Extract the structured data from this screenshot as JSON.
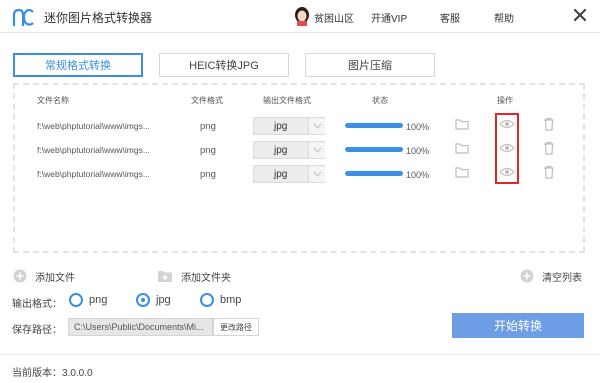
{
  "header": {
    "title": "迷你图片格式转换器",
    "user_name": "贫困山区",
    "nav": [
      "开通VIP",
      "客服",
      "帮助"
    ],
    "brand_color": "#3a8ee6"
  },
  "tabs": [
    {
      "label": "常规格式转换",
      "active": true
    },
    {
      "label": "HEIC转换JPG",
      "active": false
    },
    {
      "label": "图片压缩",
      "active": false
    }
  ],
  "table": {
    "columns": [
      "文件名称",
      "文件格式",
      "输出文件格式",
      "状态",
      "操作"
    ],
    "rows": [
      {
        "file": "f:\\web\\phptutorial\\www\\imgs...",
        "format": "png",
        "output": "jpg",
        "progress": 100,
        "status": "100%"
      },
      {
        "file": "f:\\web\\phptutorial\\www\\imgs...",
        "format": "png",
        "output": "jpg",
        "progress": 100,
        "status": "100%"
      },
      {
        "file": "f:\\web\\phptutorial\\www\\imgs...",
        "format": "png",
        "output": "jpg",
        "progress": 100,
        "status": "100%"
      }
    ],
    "row_icons": [
      "folder-icon",
      "eye-icon",
      "trash-icon"
    ]
  },
  "actions": {
    "add_file": "添加文件",
    "add_folder": "添加文件夹",
    "clear_list": "清空列表"
  },
  "output_format": {
    "label": "输出格式：",
    "options": [
      "png",
      "jpg",
      "bmp"
    ],
    "selected": "jpg"
  },
  "save_path": {
    "label": "保存路径：",
    "value": "C:\\Users\\Public\\Documents\\Mi...",
    "change_label": "更改路径"
  },
  "start_button": "开始转换",
  "footer": {
    "version": "当前版本：3.0.0.0"
  },
  "colors": {
    "accent": "#3a8ee6",
    "start_button": "#6d9de5",
    "highlight": "#e0252b"
  }
}
